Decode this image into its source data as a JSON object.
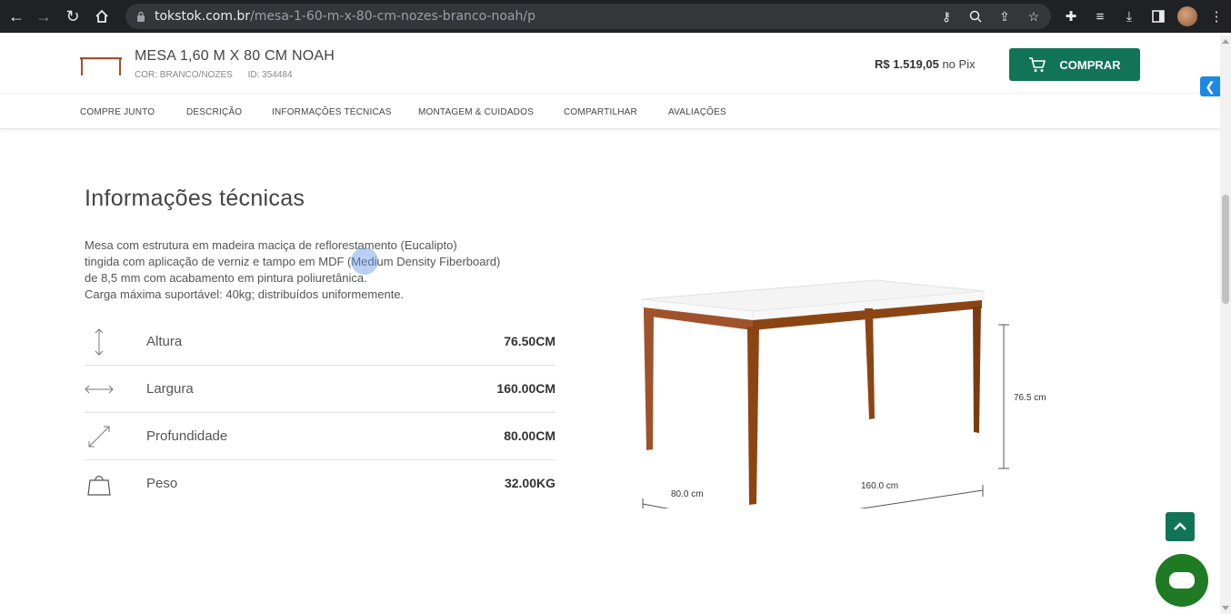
{
  "browser": {
    "url_host": "tokstok.com.br",
    "url_path": "/mesa-1-60-m-x-80-cm-nozes-branco-noah/p"
  },
  "product": {
    "title": "MESA 1,60 M X 80 CM NOAH",
    "color_label": "COR: BRANCO/NOZES",
    "id_label": "ID: 354484",
    "price": "R$ 1.519,05",
    "price_suffix": " no Pix",
    "buy_label": "COMPRAR"
  },
  "section_nav": [
    "COMPRE JUNTO",
    "DESCRIÇÃO",
    "INFORMAÇÕES TÉCNICAS",
    "MONTAGEM & CUIDADOS",
    "COMPARTILHAR",
    "AVALIAÇÕES"
  ],
  "tech_info": {
    "heading": "Informações técnicas",
    "description_lines": [
      "Mesa com estrutura em madeira maciça de reflorestamento (Eucalipto)",
      "tingida com aplicação de verniz e tampo em MDF (Medium Density Fiberboard)",
      "de 8,5 mm com acabamento em pintura poliuretânica.",
      "Carga máxima suportável: 40kg; distribuídos uniformemente."
    ],
    "specs": [
      {
        "icon": "height-arrows-icon",
        "label": "Altura",
        "value": "76.50CM"
      },
      {
        "icon": "width-arrows-icon",
        "label": "Largura",
        "value": "160.00CM"
      },
      {
        "icon": "depth-arrows-icon",
        "label": "Profundidade",
        "value": "80.00CM"
      },
      {
        "icon": "weight-icon",
        "label": "Peso",
        "value": "32.00KG"
      }
    ]
  },
  "illustration": {
    "height_label": "76.5 cm",
    "depth_label": "80.0 cm",
    "width_label": "160.0 cm"
  },
  "colors": {
    "brand_green": "#127456",
    "chat_green": "#1e7b23",
    "side_tab_blue": "#1e88e5"
  }
}
